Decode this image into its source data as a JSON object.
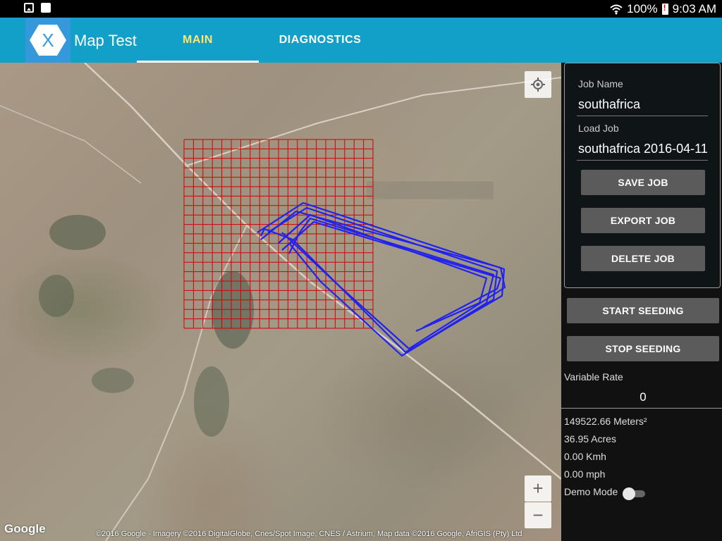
{
  "status_bar": {
    "battery": "100%",
    "time": "9:03 AM",
    "icons": [
      "image-notification-icon",
      "briefcase-notification-icon",
      "wifi-icon",
      "battery-alert-icon"
    ]
  },
  "app": {
    "title": "Map Test",
    "logo_letter": "X",
    "tabs": [
      {
        "label": "MAIN",
        "selected": true
      },
      {
        "label": "DIAGNOSTICS",
        "selected": false
      }
    ],
    "colors": {
      "appbar": "#12a0c8",
      "tab_selected": "#ffe66b",
      "grid": "#d00000",
      "track": "#2222ee"
    }
  },
  "map": {
    "google_logo": "Google",
    "attribution": "©2016 Google - Imagery ©2016 DigitalGlobe, Cnes/Spot Image, CNES / Astrium, Map data ©2016 Google, AfriGIS (Pty) Ltd",
    "zoom_in": "+",
    "zoom_out": "−"
  },
  "panel": {
    "job_name_label": "Job Name",
    "job_name_value": "southafrica",
    "load_job_label": "Load Job",
    "load_job_value": "southafrica 2016-04-11",
    "save_job": "SAVE JOB",
    "export_job": "EXPORT JOB",
    "delete_job": "DELETE JOB",
    "start_seeding": "START SEEDING",
    "stop_seeding": "STOP SEEDING",
    "variable_rate_label": "Variable Rate",
    "variable_rate_value": "0",
    "area_m2": "149522.66 Meters²",
    "area_acres": "36.95 Acres",
    "speed_kmh": "0.00 Kmh",
    "speed_mph": "0.00 mph",
    "demo_mode_label": "Demo Mode",
    "demo_mode_on": false
  }
}
